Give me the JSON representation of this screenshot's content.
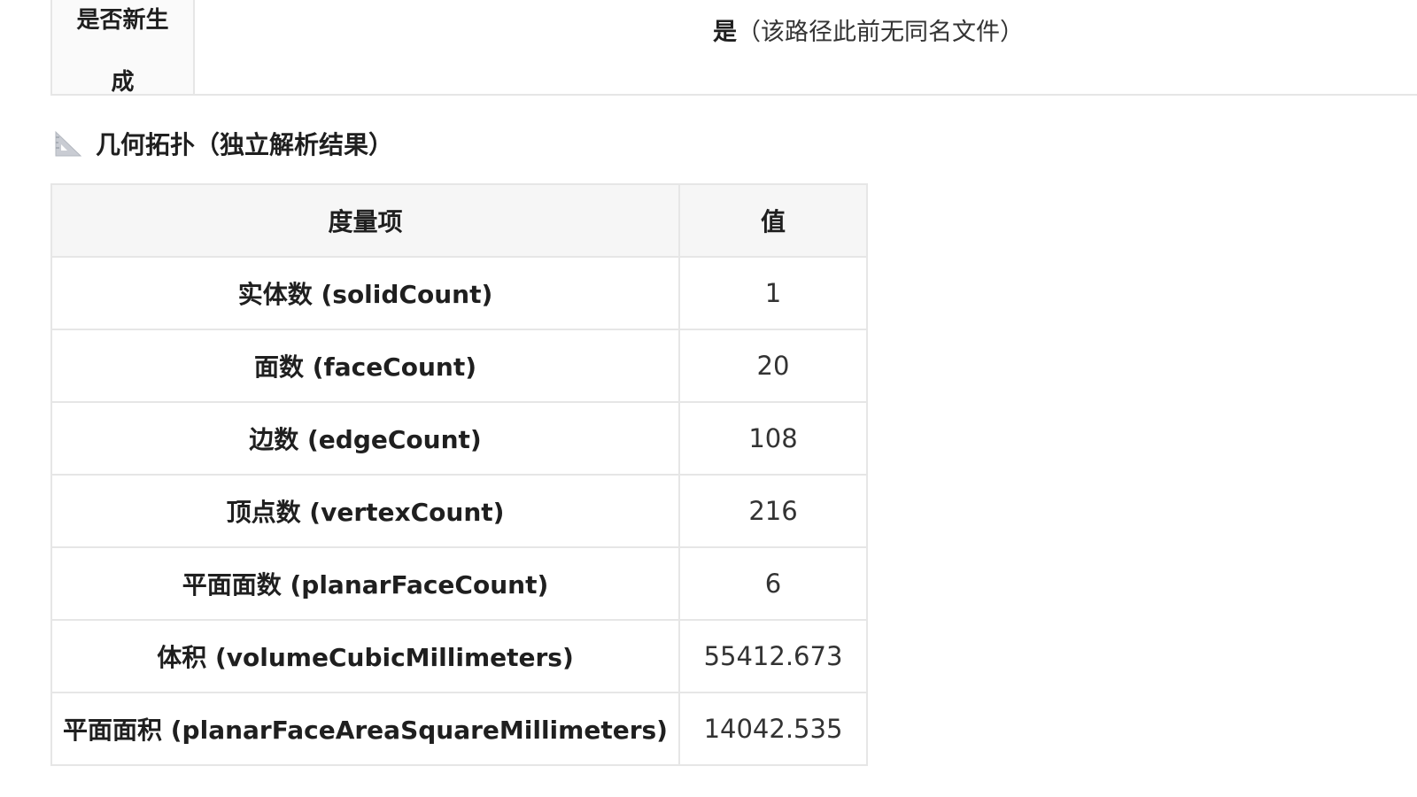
{
  "top_row": {
    "label": "是否新生\n成",
    "value_bold": "是",
    "value_rest": "（该路径此前无同名文件）"
  },
  "section": {
    "icon": "triangle-ruler-icon",
    "title": "几何拓扑（独立解析结果）"
  },
  "table": {
    "headers": {
      "metric": "度量项",
      "value": "值"
    },
    "rows": [
      {
        "metric": "实体数 (solidCount)",
        "value": "1"
      },
      {
        "metric": "面数 (faceCount)",
        "value": "20"
      },
      {
        "metric": "边数 (edgeCount)",
        "value": "108"
      },
      {
        "metric": "顶点数 (vertexCount)",
        "value": "216"
      },
      {
        "metric": "平面面数 (planarFaceCount)",
        "value": "6"
      },
      {
        "metric": "体积 (volumeCubicMillimeters)",
        "value": "55412.673"
      },
      {
        "metric": "平面面积 (planarFaceAreaSquareMillimeters)",
        "value": "14042.535"
      }
    ]
  }
}
